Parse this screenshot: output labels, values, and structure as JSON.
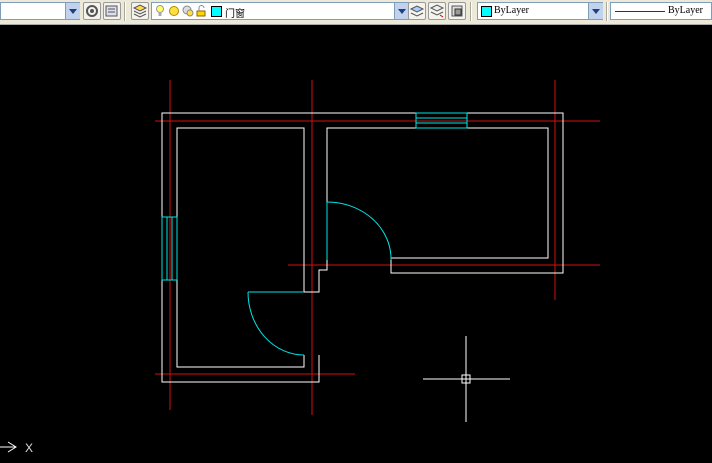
{
  "toolbar": {
    "layer_name": "门窗",
    "color_value": "ByLayer",
    "linetype_value": "ByLayer",
    "colors": {
      "layer_swatch": "#00ffff",
      "color_swatch": "#00ffff"
    }
  },
  "command_line": {
    "axis_label": "X"
  },
  "drawing": {
    "background": "#000000",
    "colors": {
      "wall": "#ffffff",
      "axis": "#ff0000",
      "door_window": "#00ffff",
      "crosshair": "#ffffff"
    }
  }
}
